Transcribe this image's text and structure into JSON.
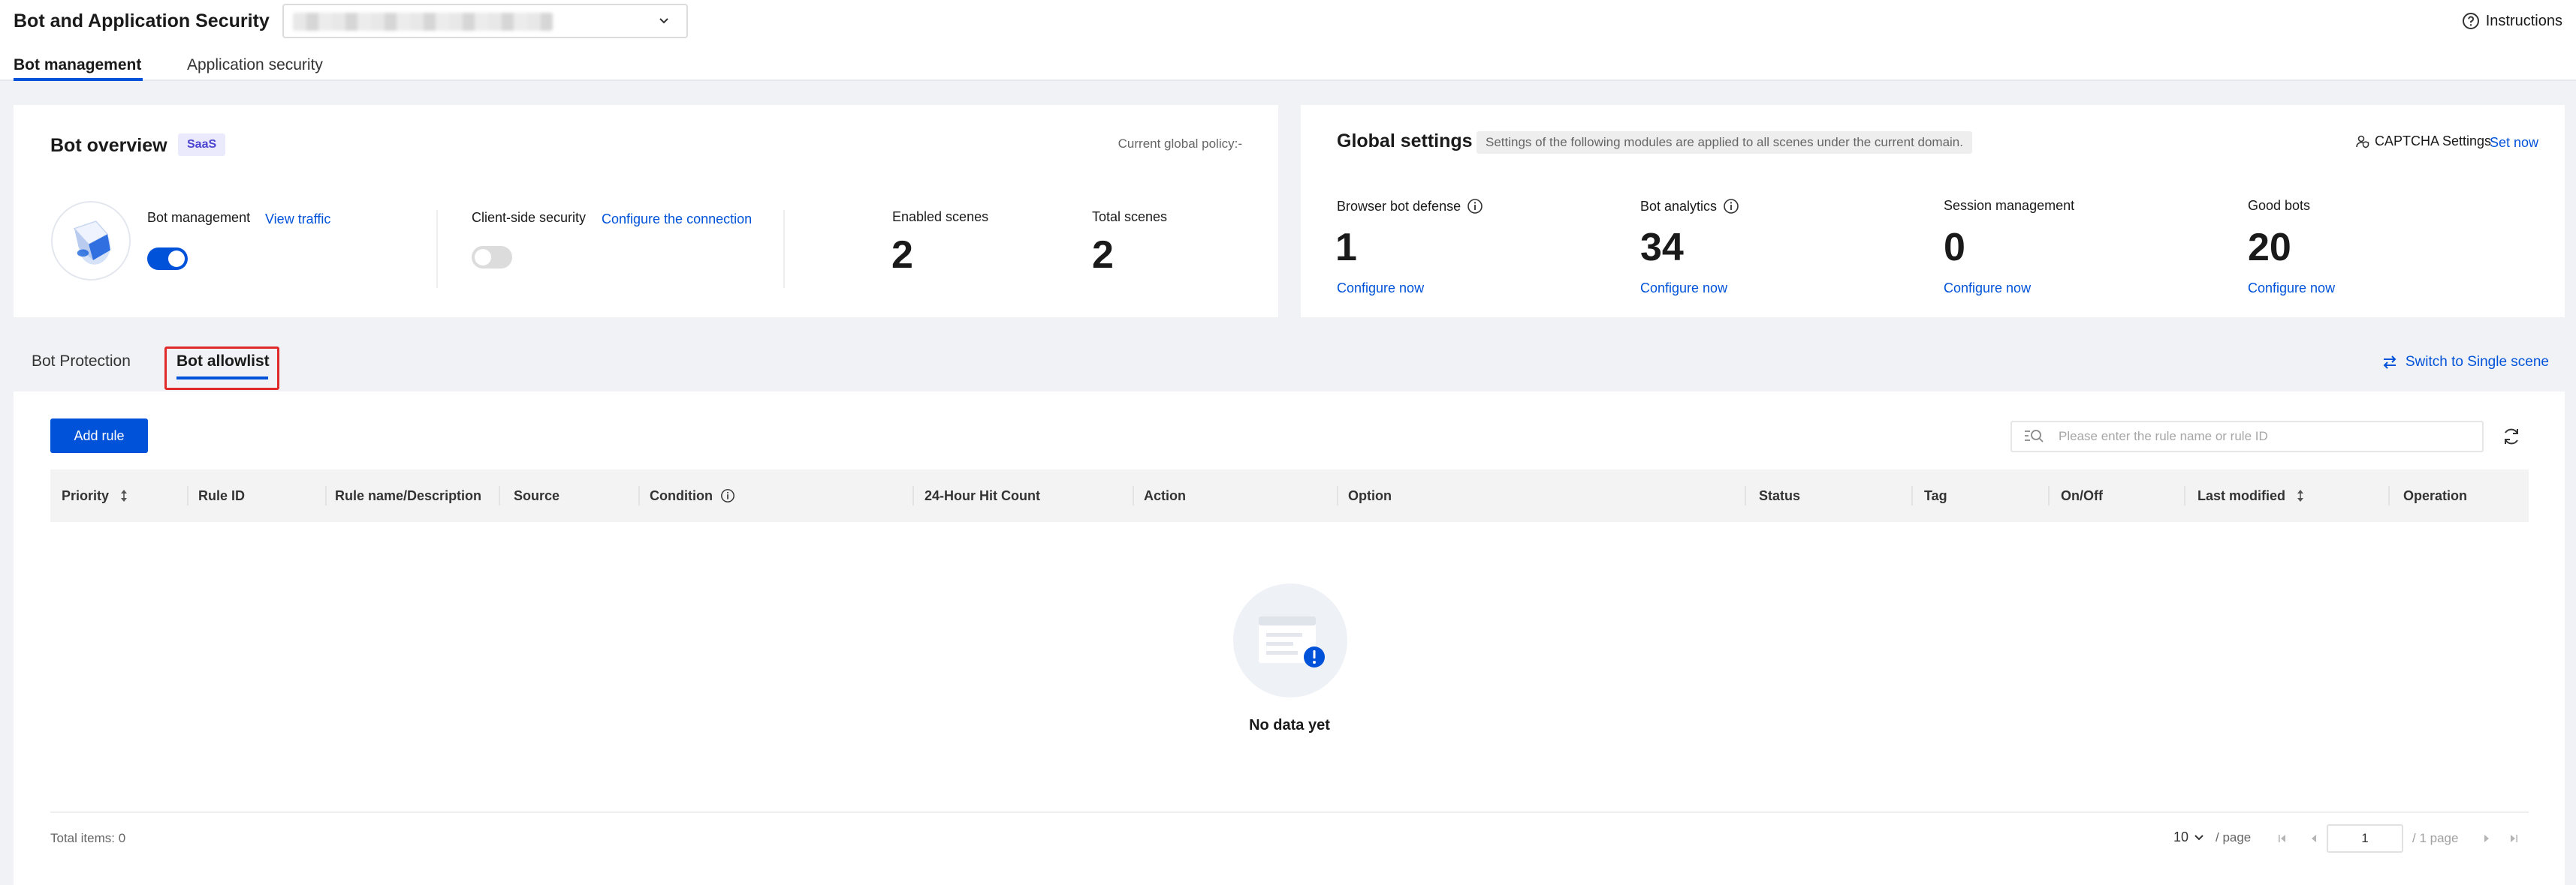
{
  "header": {
    "title": "Bot and Application Security",
    "instructions_label": "Instructions",
    "tabs": [
      {
        "label": "Bot management",
        "active": true
      },
      {
        "label": "Application security",
        "active": false
      }
    ]
  },
  "overview": {
    "title": "Bot overview",
    "badge": "SaaS",
    "global_policy": "Current global policy:-",
    "bot_management": {
      "label": "Bot management",
      "link": "View traffic",
      "enabled": true
    },
    "client_side_security": {
      "label": "Client-side security",
      "link": "Configure the connection",
      "enabled": false
    },
    "enabled_scenes": {
      "label": "Enabled scenes",
      "value": "2"
    },
    "total_scenes": {
      "label": "Total scenes",
      "value": "2"
    }
  },
  "global_settings": {
    "title": "Global settings",
    "description": "Settings of the following modules are applied to all scenes under the current domain.",
    "captcha_label": "CAPTCHA Settings",
    "captcha_link": "Set now",
    "modules": [
      {
        "label": "Browser bot defense",
        "value": "1",
        "link": "Configure now",
        "info": true
      },
      {
        "label": "Bot analytics",
        "value": "34",
        "link": "Configure now",
        "info": true
      },
      {
        "label": "Session management",
        "value": "0",
        "link": "Configure now",
        "info": false
      },
      {
        "label": "Good bots",
        "value": "20",
        "link": "Configure now",
        "info": false
      }
    ]
  },
  "subtabs": {
    "items": [
      {
        "label": "Bot Protection",
        "active": false
      },
      {
        "label": "Bot allowlist",
        "active": true
      }
    ],
    "switch_label": "Switch to Single scene"
  },
  "table": {
    "add_rule_label": "Add rule",
    "search_placeholder": "Please enter the rule name or rule ID",
    "columns": [
      {
        "label": "Priority",
        "sortable": true
      },
      {
        "label": "Rule ID"
      },
      {
        "label": "Rule name/Description"
      },
      {
        "label": "Source"
      },
      {
        "label": "Condition",
        "info": true
      },
      {
        "label": "24-Hour Hit Count"
      },
      {
        "label": "Action"
      },
      {
        "label": "Option"
      },
      {
        "label": "Status"
      },
      {
        "label": "Tag"
      },
      {
        "label": "On/Off"
      },
      {
        "label": "Last modified",
        "sortable": true
      },
      {
        "label": "Operation"
      }
    ],
    "empty_text": "No data yet",
    "rows": []
  },
  "pagination": {
    "total_items": "Total items: 0",
    "page_size": "10",
    "per_page": "/ page",
    "current_page": "1",
    "total_pages": "/ 1 page"
  },
  "colors": {
    "accent": "#0052d9",
    "highlight_box": "#e02a2a",
    "badge_bg": "#ebeafd"
  }
}
